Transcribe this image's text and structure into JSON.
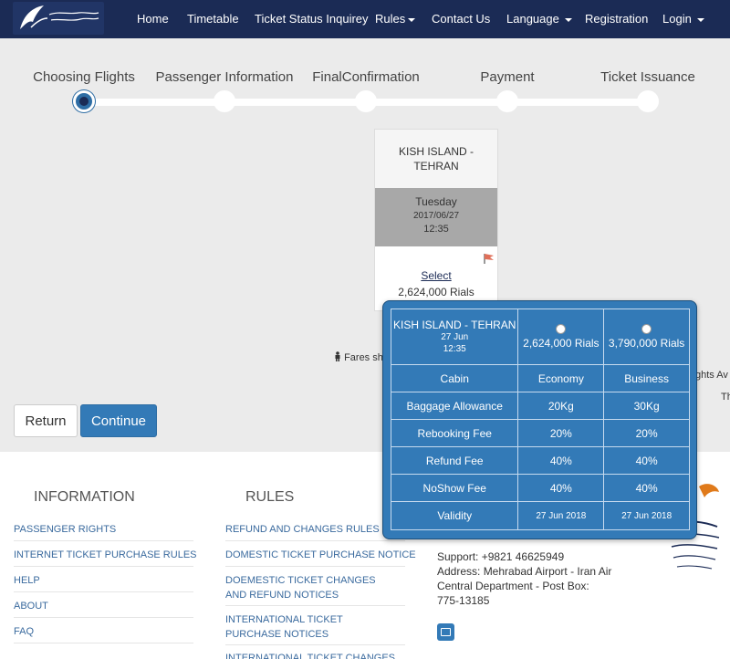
{
  "navbar": {
    "items": [
      {
        "label": "Home"
      },
      {
        "label": "Timetable"
      },
      {
        "label": "Ticket Status Inquirey"
      },
      {
        "label": "Rules"
      },
      {
        "label": "Contact Us"
      },
      {
        "label": "Language"
      },
      {
        "label": "Registration"
      },
      {
        "label": "Login"
      }
    ]
  },
  "stepper": {
    "steps": [
      {
        "label": "Choosing Flights",
        "active": true
      },
      {
        "label": "Passenger Information",
        "active": false
      },
      {
        "label": "FinalConfirmation",
        "active": false
      },
      {
        "label": "Payment",
        "active": false
      },
      {
        "label": "Ticket Issuance",
        "active": false
      }
    ]
  },
  "flight_card": {
    "route": "KISH ISLAND - TEHRAN",
    "day": "Tuesday",
    "date": "2017/06/27",
    "time": "12:35",
    "select_label": "Select",
    "price": "2,624,000 Rials"
  },
  "fares_note": "Fares sh",
  "partial_text": [
    "ghts Av",
    "Th"
  ],
  "buttons": {
    "return_label": "Return",
    "continue_label": "Continue"
  },
  "footer": {
    "information": {
      "heading": "INFORMATION",
      "links": [
        "PASSENGER RIGHTS",
        "INTERNET TICKET PURCHASE RULES",
        "HELP",
        "ABOUT",
        "FAQ"
      ]
    },
    "rules": {
      "heading": "RULES",
      "links": [
        "REFUND AND CHANGES RULES",
        "DOMESTIC TICKET PURCHASE NOTICE",
        "DOEMESTIC TICKET CHANGES AND REFUND NOTICES",
        "INTERNATIONAL TICKET PURCHASE NOTICES",
        "INTERNATIONAL TICKET CHANGES"
      ]
    },
    "contact": {
      "support": "Support: +9821 46625949",
      "address1": "Address: Mehrabad Airport - Iran Air",
      "address2": "Central Department - Post Box:",
      "address3": "775-13185"
    }
  },
  "fare_tooltip": {
    "route": "KISH ISLAND - TEHRAN",
    "date": "27 Jun",
    "time": "12:35",
    "columns": [
      {
        "price": "2,624,000 Rials",
        "cabin": "Economy",
        "baggage": "20Kg",
        "rebooking": "20%",
        "refund": "40%",
        "noshow": "40%",
        "validity": "27 Jun 2018"
      },
      {
        "price": "3,790,000 Rials",
        "cabin": "Business",
        "baggage": "30Kg",
        "rebooking": "20%",
        "refund": "40%",
        "noshow": "40%",
        "validity": "27 Jun 2018"
      }
    ],
    "row_labels": {
      "cabin": "Cabin",
      "baggage": "Baggage Allowance",
      "rebooking": "Rebooking Fee",
      "refund": "Refund Fee",
      "noshow": "NoShow Fee",
      "validity": "Validity"
    }
  },
  "colors": {
    "navbar": "#1b2b55",
    "primary": "#337ab7",
    "background": "#ebebeb"
  }
}
